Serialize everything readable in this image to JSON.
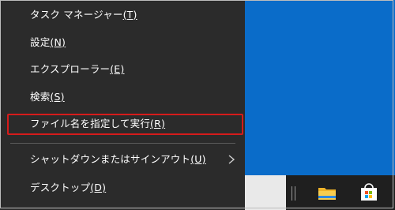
{
  "menu": {
    "items": [
      {
        "label": "タスク マネージャー",
        "accel": "(T)"
      },
      {
        "label": "設定",
        "accel": "(N)"
      },
      {
        "label": "エクスプローラー",
        "accel": "(E)"
      },
      {
        "label": "検索",
        "accel": "(S)"
      },
      {
        "label": "ファイル名を指定して実行",
        "accel": "(R)"
      },
      {
        "label": "シャットダウンまたはサインアウト",
        "accel": "(U)"
      },
      {
        "label": "デスクトップ",
        "accel": "(D)"
      }
    ]
  },
  "taskbar": {
    "icons": [
      "file-explorer-icon",
      "microsoft-store-icon"
    ]
  },
  "colors": {
    "menu_bg": "#2b2b2b",
    "desktop_blue": "#0a6cc9",
    "highlight_red": "#d61b1b"
  }
}
